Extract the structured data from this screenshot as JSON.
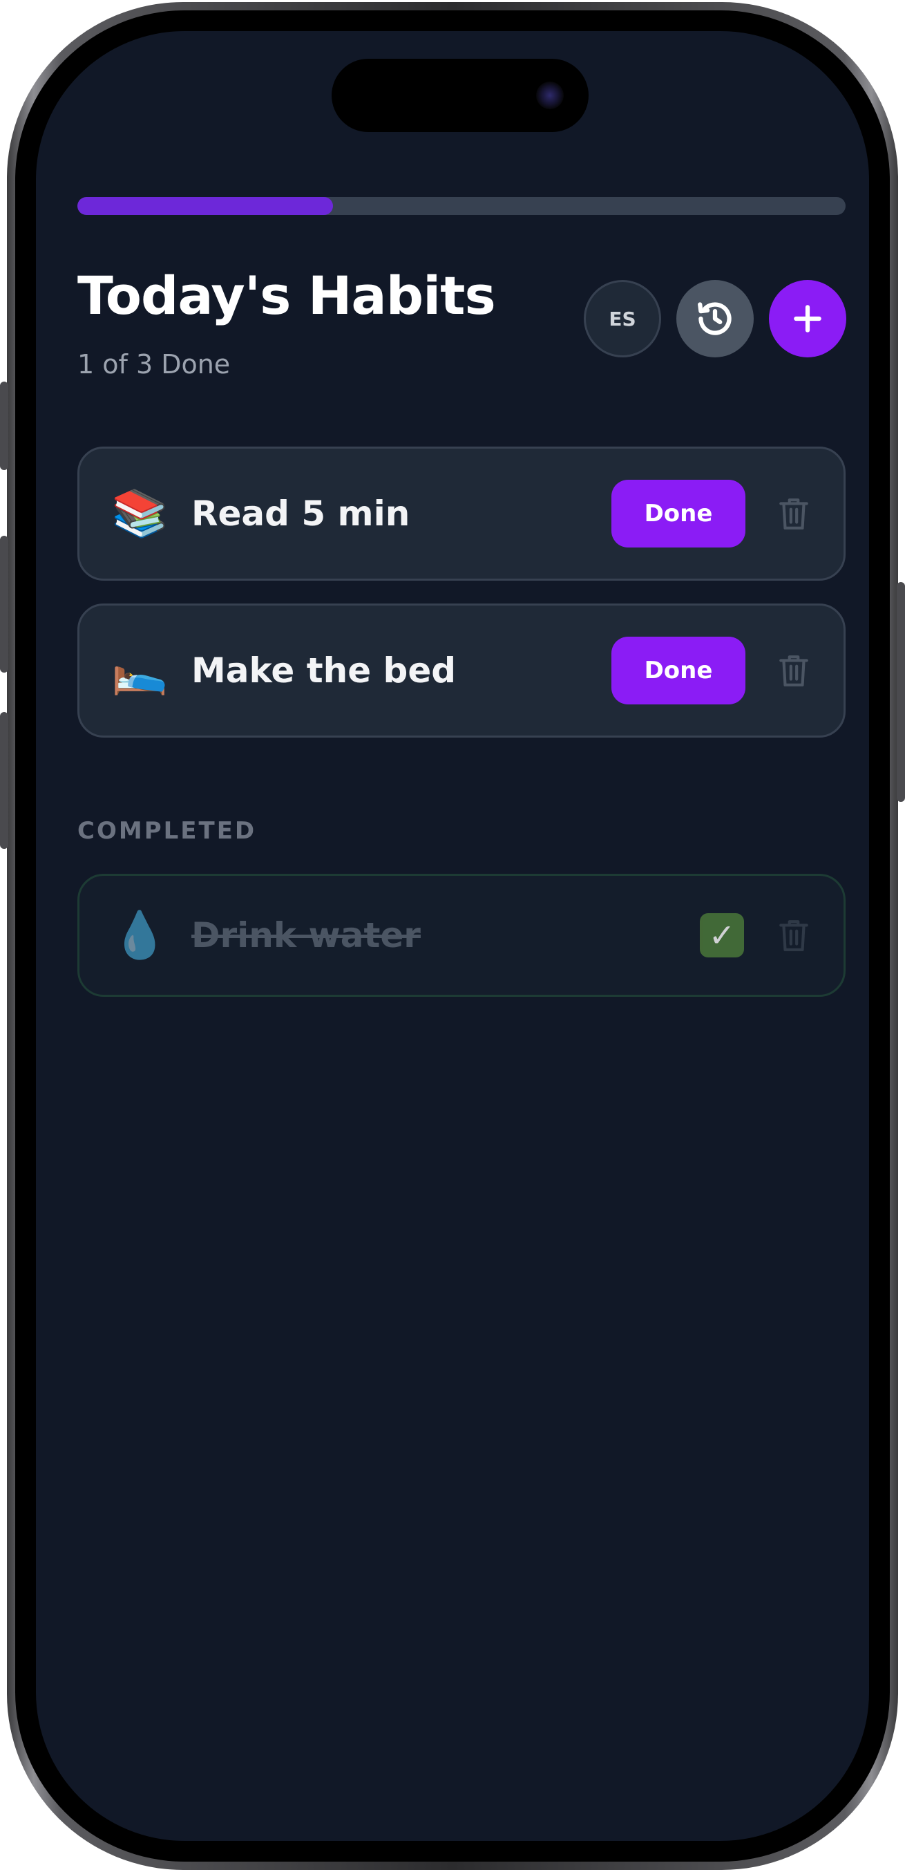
{
  "progress": {
    "completed": 1,
    "total": 3,
    "fraction": 0.333
  },
  "header": {
    "title": "Today's Habits",
    "subtitle": "1 of 3 Done",
    "language_label": "ES",
    "history_icon": "history-icon",
    "add_icon": "plus-icon"
  },
  "habits": [
    {
      "emoji": "📚",
      "name": "Read 5 min",
      "action_label": "Done"
    },
    {
      "emoji": "🛌",
      "name": "Make the bed",
      "action_label": "Done"
    }
  ],
  "completed_section": {
    "label": "COMPLETED",
    "items": [
      {
        "emoji": "💧",
        "name": "Drink water",
        "status_icon": "check-mark-icon"
      }
    ]
  },
  "colors": {
    "background": "#111827",
    "card": "#1f2937",
    "accent": "#8b1cf5",
    "progress_fill": "#6d28d9",
    "progress_track": "#374151"
  }
}
